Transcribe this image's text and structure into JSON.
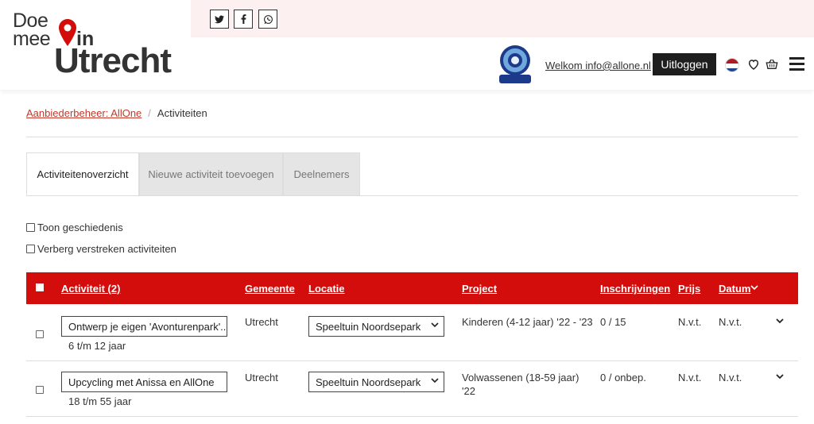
{
  "brand": {
    "line1": "Doe",
    "line2": "mee",
    "in": "in",
    "city": "Utrecht",
    "accent": "#d30c0c"
  },
  "social": [
    "twitter-icon",
    "facebook-icon",
    "whatsapp-icon"
  ],
  "header": {
    "welcome": "Welkom info@allone.nl",
    "logout_label": "Uitloggen",
    "avatar_text": "allone"
  },
  "breadcrumb": {
    "parent": "Aanbiederbeheer: AllOne",
    "current": "Activiteiten"
  },
  "tabs": [
    {
      "label": "Activiteitenoverzicht",
      "active": true
    },
    {
      "label": "Nieuwe activiteit toevoegen",
      "active": false
    },
    {
      "label": "Deelnemers",
      "active": false
    }
  ],
  "filters": {
    "show_history": "Toon geschiedenis",
    "hide_expired": "Verberg verstreken activiteiten"
  },
  "table": {
    "columns": {
      "activity": "Activiteit (2)",
      "municipality": "Gemeente",
      "location": "Locatie",
      "project": "Project",
      "registrations": "Inschrijvingen",
      "price": "Prijs",
      "date": "Datum"
    },
    "rows": [
      {
        "name": "Ontwerp je eigen 'Avonturenpark'...",
        "age": "6 t/m 12 jaar",
        "municipality": "Utrecht",
        "location": "Speeltuin Noordsepark",
        "project": "Kinderen (4-12 jaar) '22 - '23",
        "project_line2": "",
        "registrations": "0 / 15",
        "price": "N.v.t.",
        "date": "N.v.t."
      },
      {
        "name": "Upcycling met Anissa en AllOne",
        "age": "18 t/m 55 jaar",
        "municipality": "Utrecht",
        "location": "Speeltuin Noordsepark",
        "project": "Volwassenen (18-59 jaar)",
        "project_line2": "'22",
        "registrations": "0 / onbep.",
        "price": "N.v.t.",
        "date": "N.v.t."
      }
    ]
  }
}
